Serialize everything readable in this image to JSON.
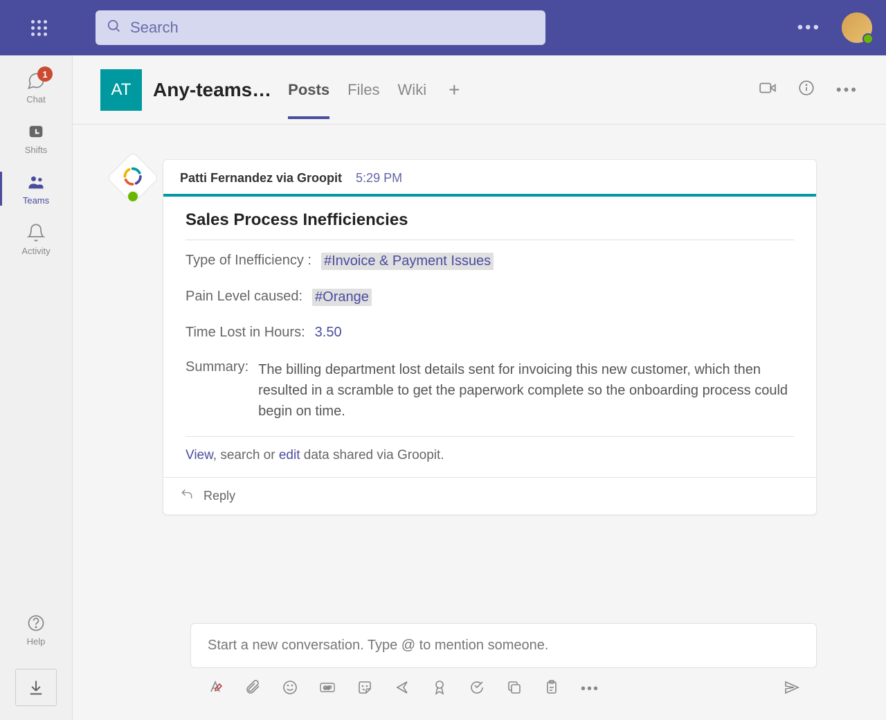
{
  "header": {
    "search_placeholder": "Search"
  },
  "sidebar": {
    "items": [
      {
        "label": "Chat",
        "badge": "1"
      },
      {
        "label": "Shifts"
      },
      {
        "label": "Teams"
      },
      {
        "label": "Activity"
      }
    ],
    "help_label": "Help"
  },
  "channel": {
    "avatar_initials": "AT",
    "name": "Any-teams…",
    "tabs": [
      {
        "label": "Posts",
        "active": true
      },
      {
        "label": "Files"
      },
      {
        "label": "Wiki"
      }
    ]
  },
  "post": {
    "author": "Patti Fernandez via Groopit",
    "time": "5:29 PM",
    "card_title": "Sales Process Inefficiencies",
    "fields": {
      "type_label": "Type of Inefficiency :",
      "type_value": "#Invoice & Payment Issues",
      "pain_label": "Pain Level caused:",
      "pain_value": "#Orange",
      "time_label": "Time Lost in Hours:",
      "time_value": "3.50",
      "summary_label": "Summary:",
      "summary_value": "The billing department lost details sent for invoicing this new customer, which then resulted in a scramble to get the paperwork complete so the onboarding process could begin on time."
    },
    "footer": {
      "view": "View",
      "mid1": ", search or ",
      "edit": "edit",
      "mid2": " data shared via Groopit."
    },
    "reply_label": "Reply"
  },
  "compose": {
    "placeholder": "Start a new conversation. Type @ to mention someone."
  }
}
